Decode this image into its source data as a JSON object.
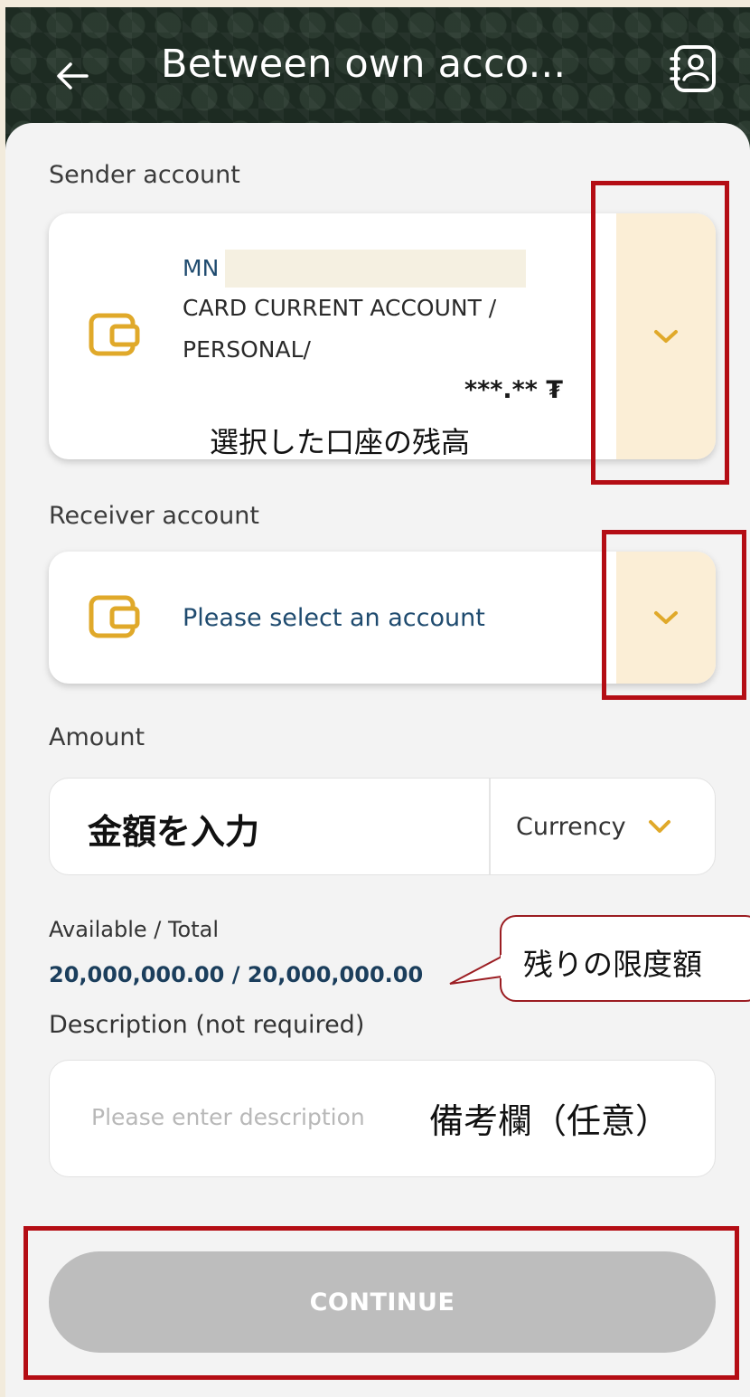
{
  "header": {
    "title": "Between own acco...",
    "back_icon": "arrow-left-icon",
    "contacts_icon": "contact-book-icon"
  },
  "sender": {
    "label": "Sender account",
    "code_prefix": "MN",
    "account_type": "CARD CURRENT ACCOUNT /",
    "account_owner": "PERSONAL/",
    "balance": "***.** ₮",
    "balance_note": "選択した口座の残高"
  },
  "receiver": {
    "label": "Receiver account",
    "placeholder": "Please select an account"
  },
  "amount": {
    "label": "Amount",
    "input_note": "金額を入力",
    "currency_label": "Currency"
  },
  "limit": {
    "label": "Available / Total",
    "value": "20,000,000.00 / 20,000,000.00",
    "callout": "残りの限度額"
  },
  "description": {
    "label": "Description (not required)",
    "placeholder": "Please enter description",
    "note": "備考欄（任意）"
  },
  "continue_label": "CONTINUE",
  "colors": {
    "accent": "#e0a92a",
    "highlight_border": "#b40d14",
    "header_bg": "#1d2b22",
    "button_disabled": "#bdbdbd"
  }
}
